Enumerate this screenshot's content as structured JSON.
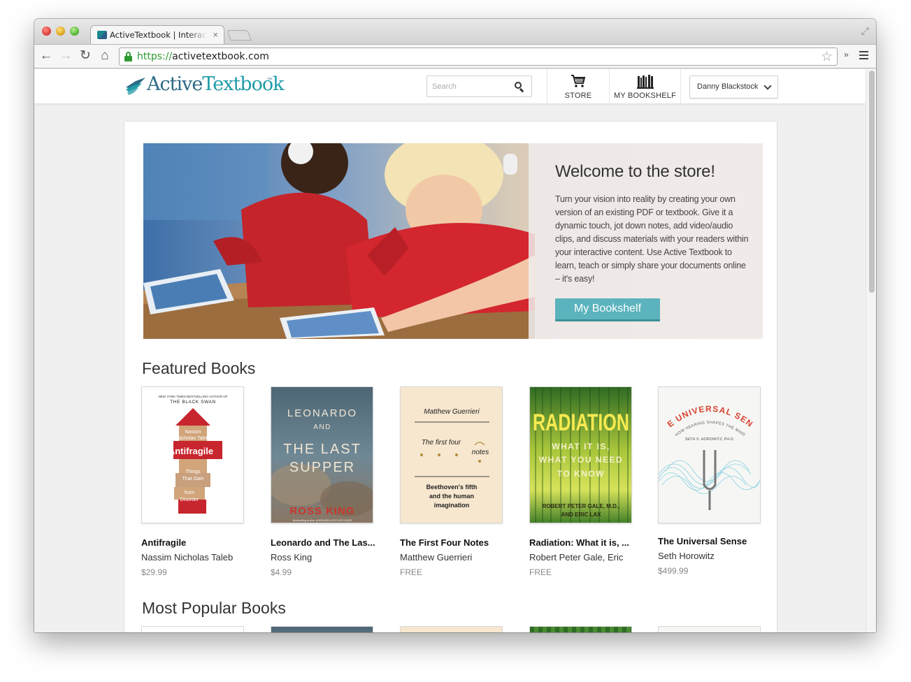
{
  "browser": {
    "tab_title": "ActiveTextbook | Interactive",
    "tab_close": "×",
    "url_scheme": "https://",
    "url_host": "activetextbook.com"
  },
  "header": {
    "logo_part1": "Active",
    "logo_part2": "Textbook",
    "logo_tm": "™",
    "search_placeholder": "Search",
    "nav": {
      "store_label": "STORE",
      "bookshelf_label": "MY BOOKSHELF"
    },
    "user_name": "Danny Blackstock"
  },
  "hero": {
    "title": "Welcome to the store!",
    "body": "Turn your vision into reality by creating your own version of an existing PDF or textbook. Give it a dynamic touch, jot down notes, add video/audio clips, and discuss materials with your readers within your interactive content. Use Active Textbook to learn, teach or simply share your documents online – it's easy!",
    "button_label": "My Bookshelf"
  },
  "sections": {
    "featured_title": "Featured Books",
    "popular_title": "Most Popular Books"
  },
  "featured_books": [
    {
      "title": "Antifragile",
      "author": "Nassim Nicholas Taleb",
      "price": "$29.99",
      "cover": {
        "top_line": "NEW YORK TIMES BESTSELLING AUTHOR OF",
        "top_line2": "THE BLACK SWAN",
        "author_line1": "Nassim",
        "author_line2": "Nicholas Taleb",
        "title": "Antifragile",
        "sub1": "Things",
        "sub2": "That Gain",
        "sub3": "from",
        "sub4": "Disorder"
      }
    },
    {
      "title": "Leonardo and The Las...",
      "author": "Ross King",
      "price": "$4.99",
      "cover": {
        "line1": "LEONARDO",
        "line2": "AND",
        "line3": "THE LAST",
        "line4": "SUPPER",
        "author": "ROSS KING",
        "tagline": "Bestselling author of BRUNELLESCHI'S DOME"
      }
    },
    {
      "title": "The First Four Notes",
      "author": "Matthew Guerrieri",
      "price": "FREE",
      "cover": {
        "author": "Matthew Guerrieri",
        "title1": "The first four",
        "title2": "notes",
        "sub1": "Beethoven's fifth",
        "sub2": "and the human",
        "sub3": "imagination"
      }
    },
    {
      "title": "Radiation: What it is, ...",
      "author": "Robert Peter Gale, Eric",
      "price": "FREE",
      "cover": {
        "title": "RADIATION",
        "sub1": "WHAT IT IS,",
        "sub2": "WHAT YOU NEED",
        "sub3": "TO KNOW",
        "authors1": "ROBERT PETER GALE, M.D.,",
        "authors2": "AND ERIC LAX"
      }
    },
    {
      "title": "The Universal Sense",
      "author": "Seth Horowitz",
      "price": "$499.99",
      "cover": {
        "title": "THE UNIVERSAL SENSE",
        "subtitle": "HOW HEARING SHAPES THE MIND",
        "author": "SETH S. HOROWITZ, PH.D."
      }
    }
  ],
  "colors": {
    "accent_teal": "#5bb3bd",
    "logo_blue": "#2b6a85",
    "logo_teal": "#1f9ba8",
    "ssl_green": "#2f9a33"
  }
}
